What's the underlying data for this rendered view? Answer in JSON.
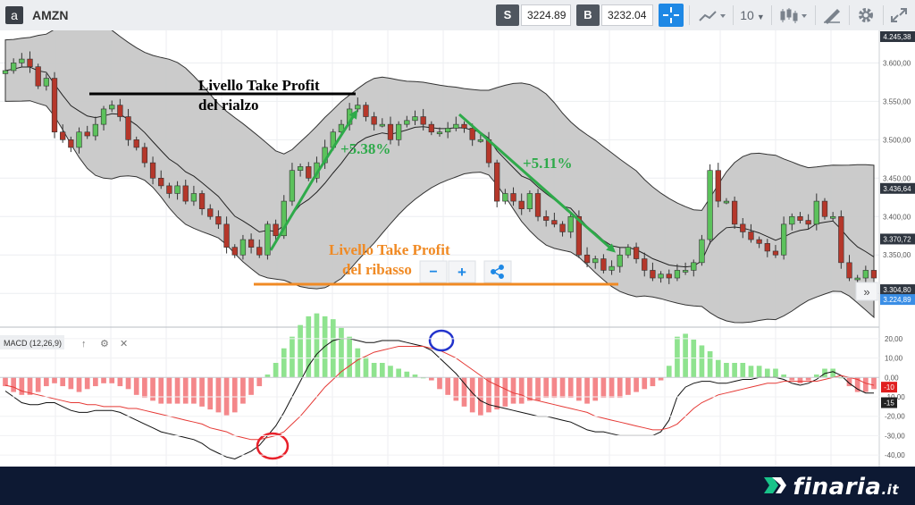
{
  "toolbar": {
    "symbol": "AMZN",
    "sell_label": "S",
    "sell_price": "3224.89",
    "buy_label": "B",
    "buy_price": "3232.04",
    "timeframe": "10",
    "icons": [
      "amazon-logo",
      "crosshair-icon",
      "chart-type-icon",
      "candles-icon",
      "draw-icon",
      "settings-icon",
      "fullscreen-icon"
    ]
  },
  "annotations": {
    "tp_up_line1": "Livello Take Profit",
    "tp_up_line2": "del rialzo",
    "tp_down_line1": "Livello Take Profit",
    "tp_down_line2": "del ribasso",
    "gain_up": "+5.38%",
    "gain_down": "+5.11%",
    "zoom_out": "−",
    "zoom_in": "+"
  },
  "macd_panel": {
    "label": "MACD (12,26,9)"
  },
  "price_axis": {
    "top_label": "4.245,38",
    "ticks": [
      "3.600,00",
      "3.550,00",
      "3.500,00",
      "3.450,00",
      "3.400,00",
      "3.350,00",
      "3.300,00"
    ],
    "badges": [
      {
        "value": "3.436,64",
        "price": 3436.64,
        "color": "#2f3640"
      },
      {
        "value": "3.370,72",
        "price": 3370.72,
        "color": "#2f3640"
      },
      {
        "value": "3.304,80",
        "price": 3304.8,
        "color": "#2f3640"
      },
      {
        "value": "3.224,89",
        "price": 3292.0,
        "color": "#3a8ee6"
      }
    ]
  },
  "macd_axis": {
    "ticks": [
      "20,00",
      "10,00",
      "0,00",
      "-10,00",
      "-20,00",
      "-30,00",
      "-40,00"
    ],
    "badges": [
      {
        "value": "-10",
        "color": "#e02020"
      },
      {
        "value": "-15",
        "color": "#222222"
      }
    ]
  },
  "colors": {
    "bull": "#5cc25c",
    "bear": "#b5372a",
    "band_fill": "#c8c8c8",
    "green_arrow": "#2eaa4a",
    "orange": "#f08a24",
    "signal": "#e53935",
    "circle_red": "#e8202a",
    "circle_blue": "#2233cc"
  },
  "brand": {
    "name": "finaria",
    "tld": ".it"
  },
  "chart_data": {
    "type": "candlestick",
    "price_range": [
      3270,
      3640
    ],
    "closes": [
      3590,
      3600,
      3605,
      3595,
      3570,
      3580,
      3510,
      3500,
      3490,
      3510,
      3505,
      3520,
      3540,
      3545,
      3530,
      3500,
      3490,
      3470,
      3450,
      3440,
      3430,
      3440,
      3420,
      3430,
      3410,
      3400,
      3390,
      3360,
      3350,
      3370,
      3360,
      3350,
      3390,
      3375,
      3420,
      3460,
      3465,
      3450,
      3470,
      3490,
      3510,
      3520,
      3540,
      3545,
      3530,
      3520,
      3520,
      3500,
      3520,
      3525,
      3530,
      3520,
      3510,
      3510,
      3515,
      3520,
      3515,
      3500,
      3500,
      3470,
      3420,
      3430,
      3420,
      3410,
      3430,
      3400,
      3395,
      3390,
      3380,
      3400,
      3350,
      3340,
      3345,
      3330,
      3335,
      3350,
      3360,
      3345,
      3330,
      3320,
      3325,
      3320,
      3330,
      3330,
      3340,
      3370,
      3460,
      3420,
      3420,
      3390,
      3380,
      3370,
      3365,
      3355,
      3350,
      3390,
      3400,
      3395,
      3390,
      3420,
      3400,
      3400,
      3340,
      3320,
      3320,
      3330,
      3320
    ],
    "macd_range": [
      -45,
      25
    ],
    "macd_ticks": [
      20,
      10,
      0,
      -10,
      -20,
      -30,
      -40
    ],
    "macd": [
      -7,
      -10,
      -13,
      -14,
      -14,
      -13,
      -13,
      -15,
      -17,
      -18,
      -18,
      -17,
      -17,
      -17,
      -18,
      -20,
      -22,
      -24,
      -26,
      -28,
      -29,
      -30,
      -31,
      -32,
      -34,
      -37,
      -39,
      -41,
      -42,
      -40,
      -38,
      -35,
      -30,
      -25,
      -18,
      -10,
      -2,
      6,
      12,
      16,
      19,
      20,
      20,
      19,
      18,
      18,
      19,
      19,
      19,
      18,
      17,
      16,
      14,
      10,
      6,
      2,
      -3,
      -8,
      -12,
      -14,
      -15,
      -16,
      -17,
      -18,
      -19,
      -20,
      -20,
      -21,
      -22,
      -23,
      -25,
      -27,
      -28,
      -28,
      -29,
      -30,
      -30,
      -30,
      -30,
      -30,
      -28,
      -22,
      -10,
      -5,
      -3,
      -2,
      -2,
      -3,
      -3,
      -2,
      -1,
      -1,
      0,
      0,
      0,
      -1,
      -3,
      -4,
      -3,
      -1,
      2,
      3,
      1,
      -3,
      -6,
      -8,
      -8
    ],
    "signal": [
      -4,
      -5,
      -7,
      -8,
      -9,
      -10,
      -11,
      -12,
      -13,
      -13,
      -14,
      -14,
      -15,
      -15,
      -15,
      -16,
      -16,
      -17,
      -18,
      -19,
      -20,
      -21,
      -22,
      -23,
      -24,
      -26,
      -27,
      -28,
      -30,
      -31,
      -32,
      -32,
      -31,
      -30,
      -28,
      -24,
      -20,
      -15,
      -10,
      -5,
      -1,
      3,
      6,
      9,
      11,
      13,
      14,
      15,
      16,
      16,
      16,
      16,
      15,
      14,
      12,
      10,
      7,
      4,
      1,
      -2,
      -4,
      -6,
      -8,
      -9,
      -11,
      -12,
      -13,
      -14,
      -15,
      -16,
      -17,
      -18,
      -20,
      -21,
      -22,
      -23,
      -24,
      -25,
      -26,
      -27,
      -27,
      -26,
      -24,
      -20,
      -16,
      -13,
      -11,
      -9,
      -8,
      -7,
      -6,
      -5,
      -4,
      -3,
      -3,
      -2,
      -2,
      -2,
      -2,
      -2,
      -1,
      0,
      1,
      0,
      -1,
      -3,
      -4
    ]
  }
}
